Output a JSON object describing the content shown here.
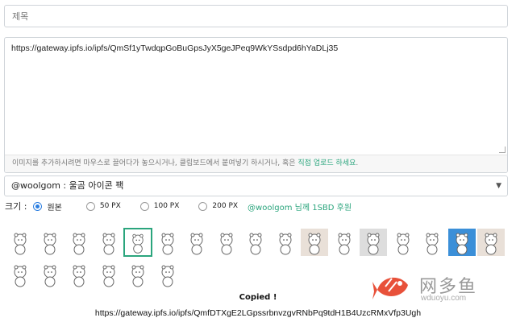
{
  "title_field": {
    "placeholder": "제목"
  },
  "editor": {
    "value": "https://gateway.ipfs.io/ipfs/QmSf1yTwdqpGoBuGpsJyX5geJPeq9WkYSsdpd6hYaDLj35",
    "hint_prefix": "이미지를 추가하시려면 마우스로 끌어다가 놓으시거나, 클립보드에서 붙여넣기 하시거나, 혹은 ",
    "hint_link": "직접 업로드 하세요",
    "hint_suffix": "."
  },
  "pack_select": {
    "selected": "@woolgom : 울곰 아이콘 팩"
  },
  "size": {
    "label": "크기 :",
    "options": [
      "원본",
      "50 PX",
      "100 PX",
      "200 PX"
    ],
    "selected_index": 0,
    "donate_text": "@woolgom 님께 1SBD 후원"
  },
  "icons": {
    "names": [
      "bear-cart-icon",
      "bear-bag-icon",
      "bear-carry-icon",
      "bear-umbrella-icon",
      "bear-arms-up-icon",
      "bear-run-icon",
      "bear-lying-icon",
      "bear-crawl-icon",
      "bear-scooter-icon",
      "bear-walk-icon",
      "bear-door-icon",
      "bear-sleep-icon",
      "bear-cave-icon",
      "bear-stand-icon",
      "bear-sad-icon",
      "bear-jump-icon",
      "bear-wall-icon",
      "bear-sit-icon",
      "bear-back-icon",
      "bear-rabbit-icon",
      "bear-flower-icon",
      "bear-fall-icon",
      "bear-hug-icon"
    ],
    "selected_index": 4
  },
  "status": {
    "copied_text": "Copied !",
    "copied_url": "https://gateway.ipfs.io/ipfs/QmfDTXgE2LGpssrbnvzgvRNbPq9tdH1B4UzcRMxVfp3Ugh"
  },
  "watermark": {
    "text": "网多鱼",
    "sub": "wduoyu.com",
    "color": "#e8513a"
  }
}
